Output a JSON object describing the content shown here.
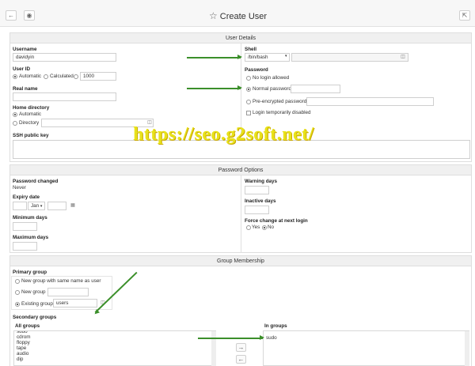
{
  "header": {
    "back_icon": "back-icon",
    "help_icon": "help-icon",
    "star_icon": "star-icon",
    "title": "Create User",
    "expand_icon": "expand-icon"
  },
  "user_details": {
    "section_title": "User Details",
    "username_label": "Username",
    "username_value": "davidyin",
    "uid_label": "User ID",
    "uid_options": [
      "Automatic",
      "Calculated"
    ],
    "uid_value": "1000",
    "realname_label": "Real name",
    "home_label": "Home directory",
    "home_options": [
      "Automatic",
      "Directory"
    ],
    "ssh_label": "SSH public key",
    "shell_label": "Shell",
    "shell_value": "/bin/bash",
    "password_label": "Password",
    "password_options": [
      "No login allowed",
      "Normal password",
      "Pre-encrypted password"
    ],
    "login_disabled_label": "Login temporarily disabled"
  },
  "password_options": {
    "section_title": "Password Options",
    "changed_label": "Password changed",
    "changed_value": "Never",
    "expiry_label": "Expiry date",
    "expiry_month": "Jan",
    "min_days_label": "Minimum days",
    "max_days_label": "Maximum days",
    "warning_label": "Warning days",
    "inactive_label": "Inactive days",
    "force_label": "Force change at next login",
    "force_options": [
      "Yes",
      "No"
    ]
  },
  "group_membership": {
    "section_title": "Group Membership",
    "primary_label": "Primary group",
    "primary_options": [
      "New group with same name as user",
      "New group",
      "Existing group"
    ],
    "existing_value": "users",
    "secondary_label": "Secondary groups",
    "all_groups_label": "All groups",
    "all_groups": [
      "sudo",
      "cdrom",
      "floppy",
      "tape",
      "audio",
      "dip"
    ],
    "in_groups_label": "In groups",
    "in_groups": [
      "sudo"
    ],
    "add_arrow": "→",
    "remove_arrow": "←"
  },
  "watermark": "https://seo.g2soft.net/",
  "colors": {
    "arrow": "#3b8f2a",
    "watermark": "#e8e21a",
    "header_bg": "#f7f7f7",
    "section_bg": "#f0f0f0"
  }
}
